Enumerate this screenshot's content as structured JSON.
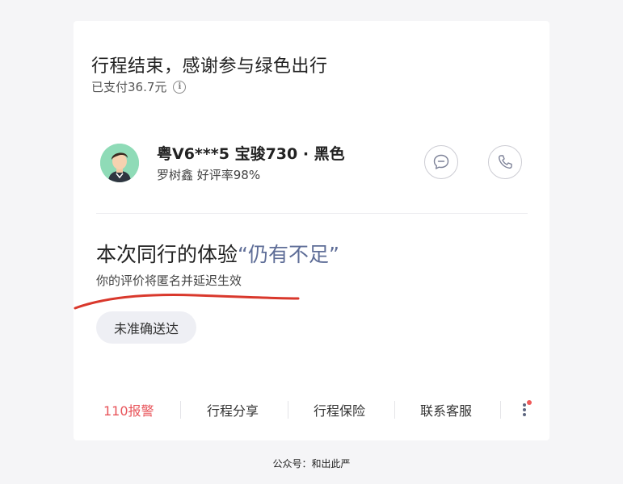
{
  "trip": {
    "title": "行程结束，感谢参与绿色出行",
    "paid": "已支付36.7元",
    "info_icon": "i"
  },
  "driver": {
    "plate_info": "粤V6***5 宝骏730 · 黑色",
    "meta": "罗树鑫  好评率98%"
  },
  "experience": {
    "title_prefix": "本次同行的体验",
    "title_highlight": "“仍有不足”",
    "subtitle": "你的评价将匿名并延迟生效",
    "tag": "未准确送达"
  },
  "actions": {
    "alarm": "110报警",
    "share": "行程分享",
    "insurance": "行程保险",
    "service": "联系客服"
  },
  "colors": {
    "highlight": "#5e6d97",
    "alarm": "#e8545a",
    "annotation_red": "#d9382c"
  },
  "watermark": "公众号：和出此严"
}
